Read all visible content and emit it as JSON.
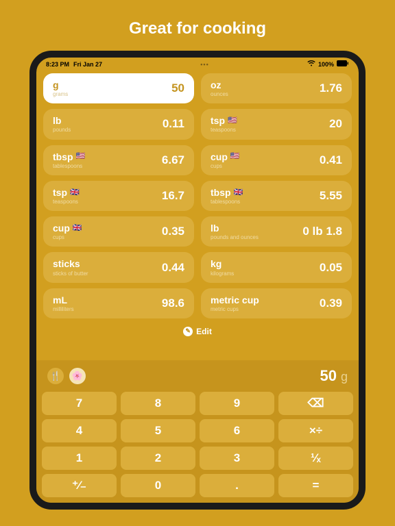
{
  "marketing": {
    "title": "Great for cooking"
  },
  "status": {
    "time": "8:23 PM",
    "date": "Fri Jan 27",
    "battery_pct": "100%"
  },
  "tiles": [
    {
      "unit": "g",
      "sub": "grams",
      "flag": "",
      "value": "50",
      "selected": true
    },
    {
      "unit": "oz",
      "sub": "ounces",
      "flag": "",
      "value": "1.76",
      "selected": false
    },
    {
      "unit": "lb",
      "sub": "pounds",
      "flag": "",
      "value": "0.11",
      "selected": false
    },
    {
      "unit": "tsp",
      "sub": "teaspoons",
      "flag": "🇺🇸",
      "value": "20",
      "selected": false
    },
    {
      "unit": "tbsp",
      "sub": "tablespoons",
      "flag": "🇺🇸",
      "value": "6.67",
      "selected": false
    },
    {
      "unit": "cup",
      "sub": "cups",
      "flag": "🇺🇸",
      "value": "0.41",
      "selected": false
    },
    {
      "unit": "tsp",
      "sub": "teaspoons",
      "flag": "🇬🇧",
      "value": "16.7",
      "selected": false
    },
    {
      "unit": "tbsp",
      "sub": "tablespoons",
      "flag": "🇬🇧",
      "value": "5.55",
      "selected": false
    },
    {
      "unit": "cup",
      "sub": "cups",
      "flag": "🇬🇧",
      "value": "0.35",
      "selected": false
    },
    {
      "unit": "lb",
      "sub": "pounds and ounces",
      "flag": "",
      "value": "0 lb 1.8",
      "selected": false
    },
    {
      "unit": "sticks",
      "sub": "sticks of butter",
      "flag": "",
      "value": "0.44",
      "selected": false
    },
    {
      "unit": "kg",
      "sub": "kilograms",
      "flag": "",
      "value": "0.05",
      "selected": false
    },
    {
      "unit": "mL",
      "sub": "milliliters",
      "flag": "",
      "value": "98.6",
      "selected": false
    },
    {
      "unit": "metric cup",
      "sub": "metric cups",
      "flag": "",
      "value": "0.39",
      "selected": false
    }
  ],
  "edit": {
    "label": "Edit"
  },
  "readout": {
    "value": "50",
    "unit": "g"
  },
  "icons": {
    "utensils": "🍴",
    "flower": "🌸"
  },
  "keys": {
    "k7": "7",
    "k8": "8",
    "k9": "9",
    "back": "⌫",
    "k4": "4",
    "k5": "5",
    "k6": "6",
    "muldiv": "×÷",
    "k1": "1",
    "k2": "2",
    "k3": "3",
    "inv": "¹⁄ₓ",
    "neg": "⁺⁄₋",
    "k0": "0",
    "dot": ".",
    "eq": "="
  }
}
